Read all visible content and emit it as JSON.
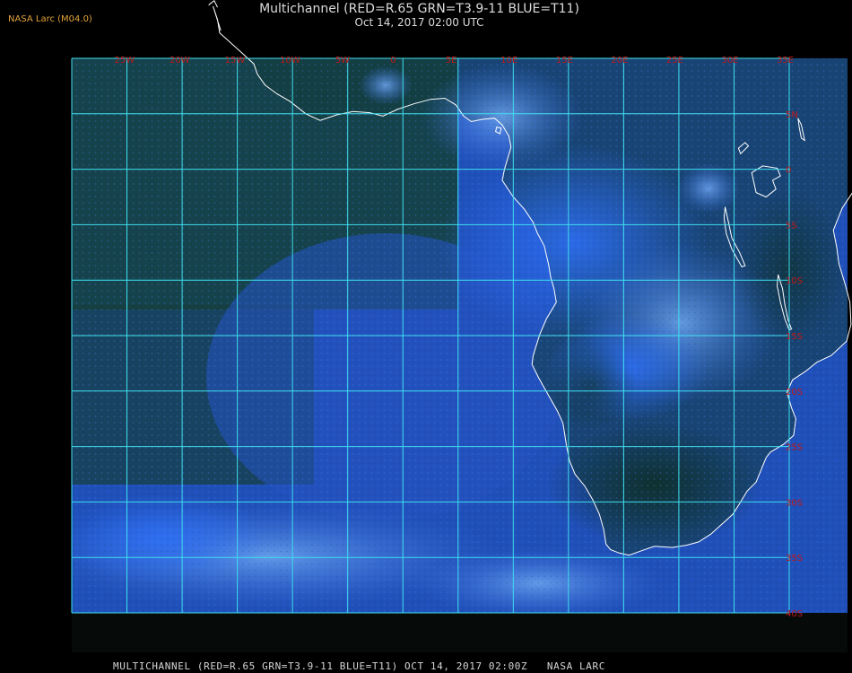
{
  "header": {
    "credit": "NASA Larc (M04.0)",
    "title": "Multichannel (RED=R.65 GRN=T3.9-11 BLUE=T11)",
    "subtitle": "Oct 14, 2017 02:00 UTC"
  },
  "footer": {
    "caption": "MULTICHANNEL (RED=R.65 GRN=T3.9-11 BLUE=T11) OCT 14, 2017 02:00Z   NASA LARC"
  },
  "map": {
    "projection": "equirectangular",
    "lon_range": [
      -30,
      35
    ],
    "lat_range": [
      -40,
      10
    ],
    "grid_step_deg": 5,
    "colors": {
      "grid": "#3fe0f0",
      "coastline": "#ffffff",
      "tick_label": "#c01818",
      "ocean": "#1f4fb8",
      "land": "#123c3c"
    },
    "lon_labels": [
      "25W",
      "20W",
      "15W",
      "10W",
      "5W",
      "0",
      "5E",
      "10E",
      "15E",
      "20E",
      "25E",
      "30E",
      "35E"
    ],
    "lat_labels": [
      "5N",
      "0",
      "5S",
      "10S",
      "15S",
      "20S",
      "25S",
      "30S",
      "35S",
      "40S"
    ]
  }
}
